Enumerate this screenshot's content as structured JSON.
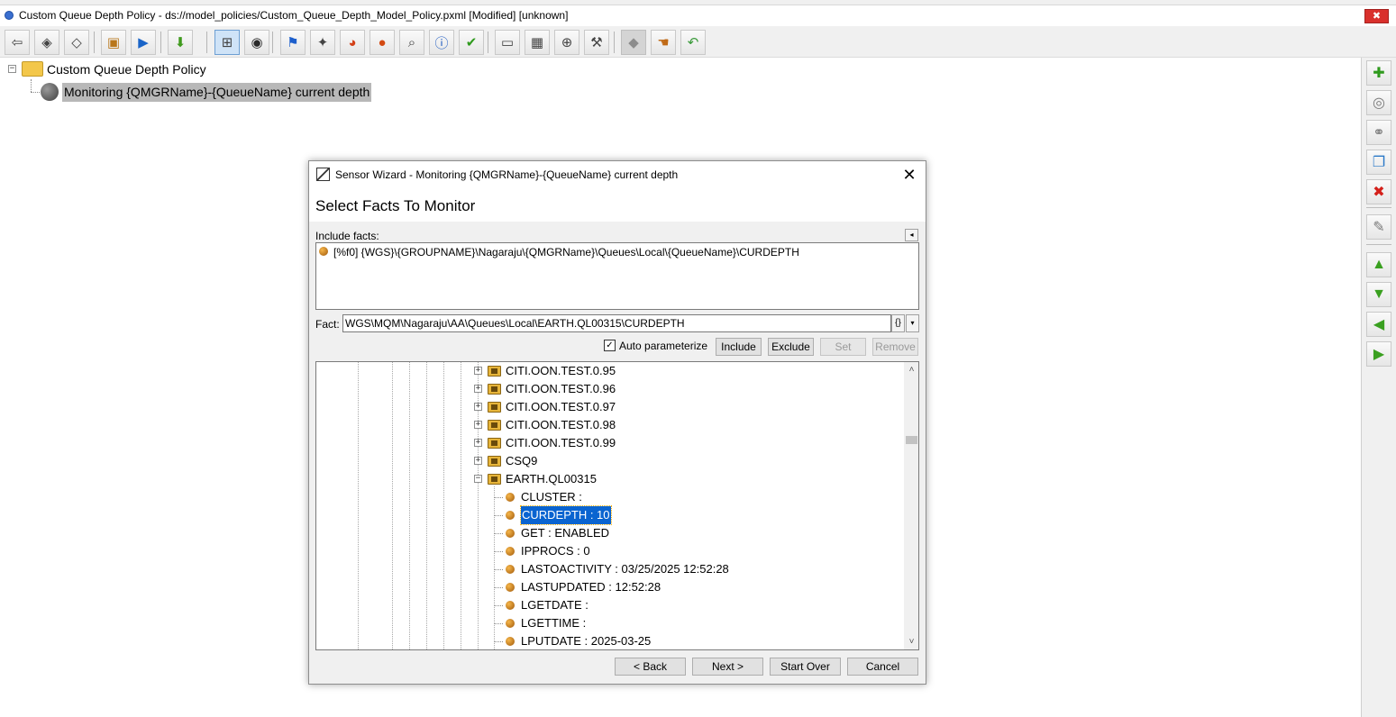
{
  "window": {
    "title": "Custom Queue Depth Policy - ds://model_policies/Custom_Queue_Depth_Model_Policy.pxml [Modified] [unknown]",
    "close_glyph": "✖"
  },
  "toolbar": {
    "buttons": [
      {
        "name": "back",
        "icon": "tag-back-icon"
      },
      {
        "name": "tag",
        "icon": "tag-icon"
      },
      {
        "name": "tag-outline",
        "icon": "tag-outline-icon"
      },
      {
        "name": "package",
        "icon": "package-icon"
      },
      {
        "name": "play",
        "icon": "play-icon"
      },
      {
        "name": "download",
        "icon": "download-arrow-icon"
      },
      {
        "name": "tree-view",
        "icon": "tree-view-icon",
        "pressed": true
      },
      {
        "name": "globe",
        "icon": "globe-icon"
      },
      {
        "name": "flag",
        "icon": "flag-icon"
      },
      {
        "name": "wizard",
        "icon": "wizard-icon"
      },
      {
        "name": "chart",
        "icon": "pie-chart-icon"
      },
      {
        "name": "alert",
        "icon": "alert-icon"
      },
      {
        "name": "search",
        "icon": "search-icon"
      },
      {
        "name": "info",
        "icon": "info-icon"
      },
      {
        "name": "check",
        "icon": "check-icon"
      },
      {
        "name": "book",
        "icon": "book-icon"
      },
      {
        "name": "calendar",
        "icon": "calendar-icon"
      },
      {
        "name": "search-plus",
        "icon": "search-plus-icon"
      },
      {
        "name": "tools",
        "icon": "tools-icon"
      },
      {
        "name": "tag-gray",
        "icon": "tag-disabled-icon",
        "disabled": true
      },
      {
        "name": "hand",
        "icon": "hand-icon"
      },
      {
        "name": "undo",
        "icon": "undo-icon"
      }
    ]
  },
  "tree": {
    "root_label": "Custom Queue Depth Policy",
    "child_label": "Monitoring {QMGRName}-{QueueName} current depth"
  },
  "side_toolbar": {
    "buttons": [
      {
        "name": "add",
        "icon": "add-icon"
      },
      {
        "name": "add-sensor",
        "icon": "add-sensor-icon"
      },
      {
        "name": "link",
        "icon": "link-icon"
      },
      {
        "name": "copy",
        "icon": "copy-icon"
      },
      {
        "name": "delete",
        "icon": "delete-icon"
      },
      {
        "name": "edit",
        "icon": "edit-icon"
      },
      {
        "name": "move-up",
        "icon": "arrow-up-icon"
      },
      {
        "name": "move-down",
        "icon": "arrow-down-icon"
      },
      {
        "name": "move-left",
        "icon": "arrow-left-icon"
      },
      {
        "name": "move-right",
        "icon": "arrow-right-icon"
      }
    ]
  },
  "dialog": {
    "title": "Sensor Wizard - Monitoring {QMGRName}-{QueueName} current depth",
    "close_glyph": "✕",
    "heading": "Select Facts To Monitor",
    "include_label": "Include facts:",
    "collapse_glyph": "◂",
    "include_items": [
      "[%f0] {WGS}\\{GROUPNAME}\\Nagaraju\\{QMGRName}\\Queues\\Local\\{QueueName}\\CURDEPTH"
    ],
    "fact_label": "Fact:",
    "fact_value": "WGS\\MQM\\Nagaraju\\AA\\Queues\\Local\\EARTH.QL00315\\CURDEPTH",
    "brace_glyph": "{}",
    "dropdown_glyph": "▾",
    "auto_parameterize": {
      "label": "Auto parameterize",
      "checked": true,
      "check_glyph": "✓"
    },
    "buttons": {
      "include": "Include",
      "exclude": "Exclude",
      "set": "Set",
      "remove": "Remove",
      "back": "< Back",
      "next": "Next >",
      "start_over": "Start Over",
      "cancel": "Cancel"
    },
    "fact_tree": {
      "items": [
        {
          "label": "CITI.OON.TEST.0.95",
          "type": "folder",
          "expander": "+"
        },
        {
          "label": "CITI.OON.TEST.0.96",
          "type": "folder",
          "expander": "+"
        },
        {
          "label": "CITI.OON.TEST.0.97",
          "type": "folder",
          "expander": "+"
        },
        {
          "label": "CITI.OON.TEST.0.98",
          "type": "folder",
          "expander": "+"
        },
        {
          "label": "CITI.OON.TEST.0.99",
          "type": "folder",
          "expander": "+"
        },
        {
          "label": "CSQ9",
          "type": "folder",
          "expander": "+"
        },
        {
          "label": "EARTH.QL00315",
          "type": "folder",
          "expander": "−"
        },
        {
          "label": "CLUSTER :",
          "type": "fact"
        },
        {
          "label": "CURDEPTH : 10",
          "type": "fact",
          "selected": true
        },
        {
          "label": "GET : ENABLED",
          "type": "fact"
        },
        {
          "label": "IPPROCS : 0",
          "type": "fact"
        },
        {
          "label": "LASTOACTIVITY : 03/25/2025 12:52:28",
          "type": "fact"
        },
        {
          "label": "LASTUPDATED : 12:52:28",
          "type": "fact"
        },
        {
          "label": "LGETDATE :",
          "type": "fact"
        },
        {
          "label": "LGETTIME :",
          "type": "fact"
        },
        {
          "label": "LPUTDATE : 2025-03-25",
          "type": "fact"
        }
      ],
      "scroll_up_glyph": "˄",
      "scroll_down_glyph": "˅"
    }
  },
  "colors": {
    "selection": "#0a64d0",
    "tree_selection": "#b8b8b8",
    "fact_bullet": "#d07f1a"
  }
}
